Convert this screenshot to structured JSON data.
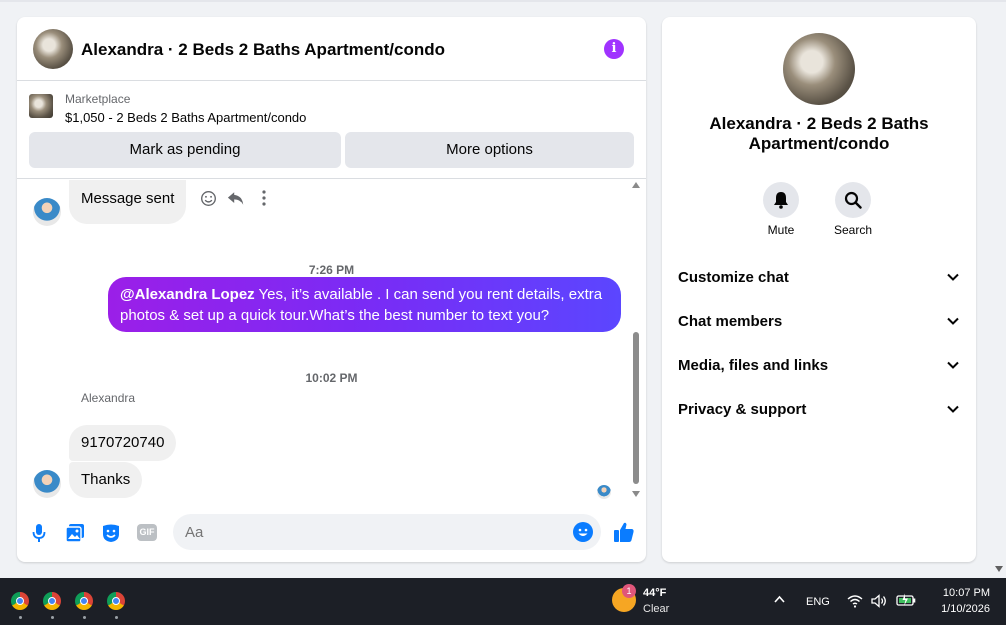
{
  "chat": {
    "title": "Alexandra · 2 Beds 2 Baths Apartment/condo",
    "listing": {
      "source": "Marketplace",
      "summary": "$1,050 - 2 Beds 2 Baths Apartment/condo",
      "mark_pending_label": "Mark as pending",
      "more_options_label": "More options"
    },
    "messages": {
      "first_incoming": "Message sent",
      "time_1": "7:26 PM",
      "outgoing_mention": "@Alexandra Lopez",
      "outgoing_text": " Yes, it’s available .  I can send you rent details, extra photos & set up a quick tour.What’s the best number to text you?",
      "time_2": "10:02 PM",
      "sender": "Alexandra",
      "incoming_1": "9170720740",
      "incoming_2": "Thanks"
    },
    "composer": {
      "placeholder": "Aa",
      "gif_label": "GIF"
    }
  },
  "info_panel": {
    "name": "Alexandra · 2 Beds 2 Baths Apartment/condo",
    "mute_label": "Mute",
    "search_label": "Search",
    "sections": [
      "Customize chat",
      "Chat members",
      "Media, files and links",
      "Privacy & support"
    ]
  },
  "taskbar": {
    "weather_badge": "1",
    "temperature": "44°F",
    "condition": "Clear",
    "language": "ENG",
    "time": "10:07 PM",
    "date": "1/10/2026"
  },
  "colors": {
    "accent": "#0a7cff",
    "outgoing_gradient_start": "#9b1fe8",
    "outgoing_gradient_end": "#5b46ff",
    "info_icon": "#a033ff"
  }
}
